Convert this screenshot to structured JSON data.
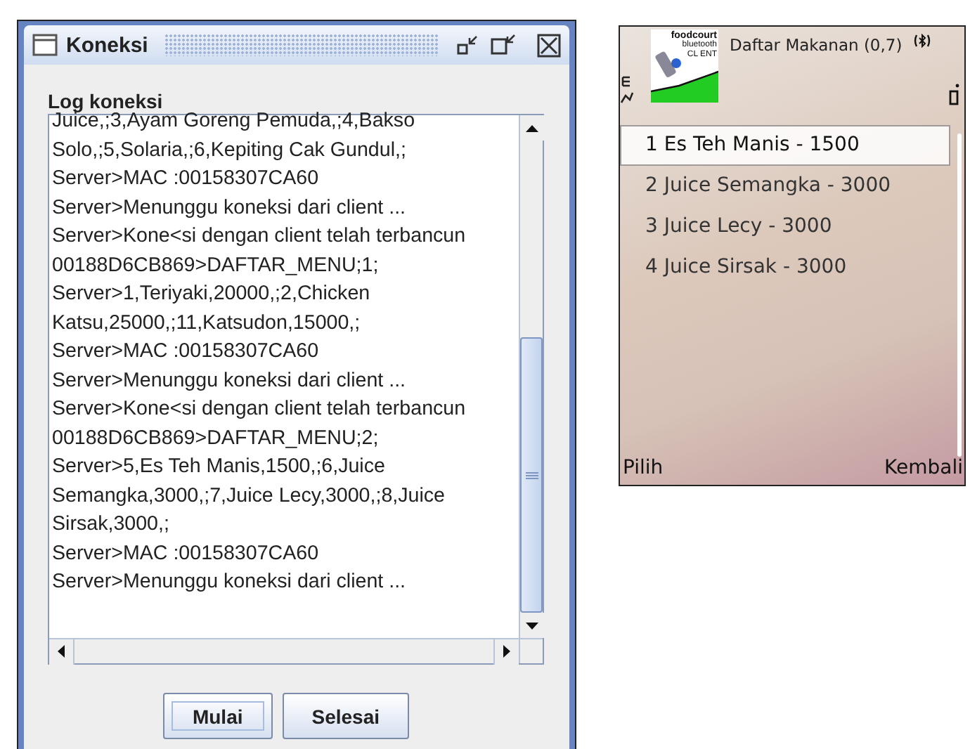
{
  "window": {
    "title": "Koneksi"
  },
  "log": {
    "label": "Log koneksi",
    "lines": [
      "Juice,;3,Ayam Goreng Pemuda,;4,Bakso",
      "Solo,;5,Solaria,;6,Kepiting Cak Gundul,;",
      "Server>MAC :00158307CA60",
      "Server>Menunggu koneksi dari client ...",
      "Server>Kone<si dengan client telah terbancun",
      "00188D6CB869>DAFTAR_MENU;1;",
      "Server>1,Teriyaki,20000,;2,Chicken",
      "Katsu,25000,;11,Katsudon,15000,;",
      "Server>MAC :00158307CA60",
      "Server>Menunggu koneksi dari client ...",
      "Server>Kone<si dengan client telah terbancun",
      "00188D6CB869>DAFTAR_MENU;2;",
      "Server>5,Es Teh Manis,1500,;6,Juice",
      "Semangka,3000,;7,Juice Lecy,3000,;8,Juice",
      "Sirsak,3000,;",
      "Server>MAC :00158307CA60",
      "Server>Menunggu koneksi dari client ..."
    ]
  },
  "buttons": [
    {
      "label": "Mulai",
      "focused": true
    },
    {
      "label": "Selesai",
      "focused": false
    }
  ],
  "phone": {
    "logo": [
      "foodcourt",
      "bluetooth",
      "CL ENT"
    ],
    "title": "Daftar Makanan (0,7)",
    "items": [
      {
        "label": "1 Es Teh Manis - 1500",
        "selected": true
      },
      {
        "label": "2 Juice Semangka - 3000",
        "selected": false
      },
      {
        "label": "3 Juice Lecy - 3000",
        "selected": false
      },
      {
        "label": "4 Juice Sirsak - 3000",
        "selected": false
      }
    ],
    "softkeys": {
      "left": "Pilih",
      "right": "Kembali"
    }
  }
}
